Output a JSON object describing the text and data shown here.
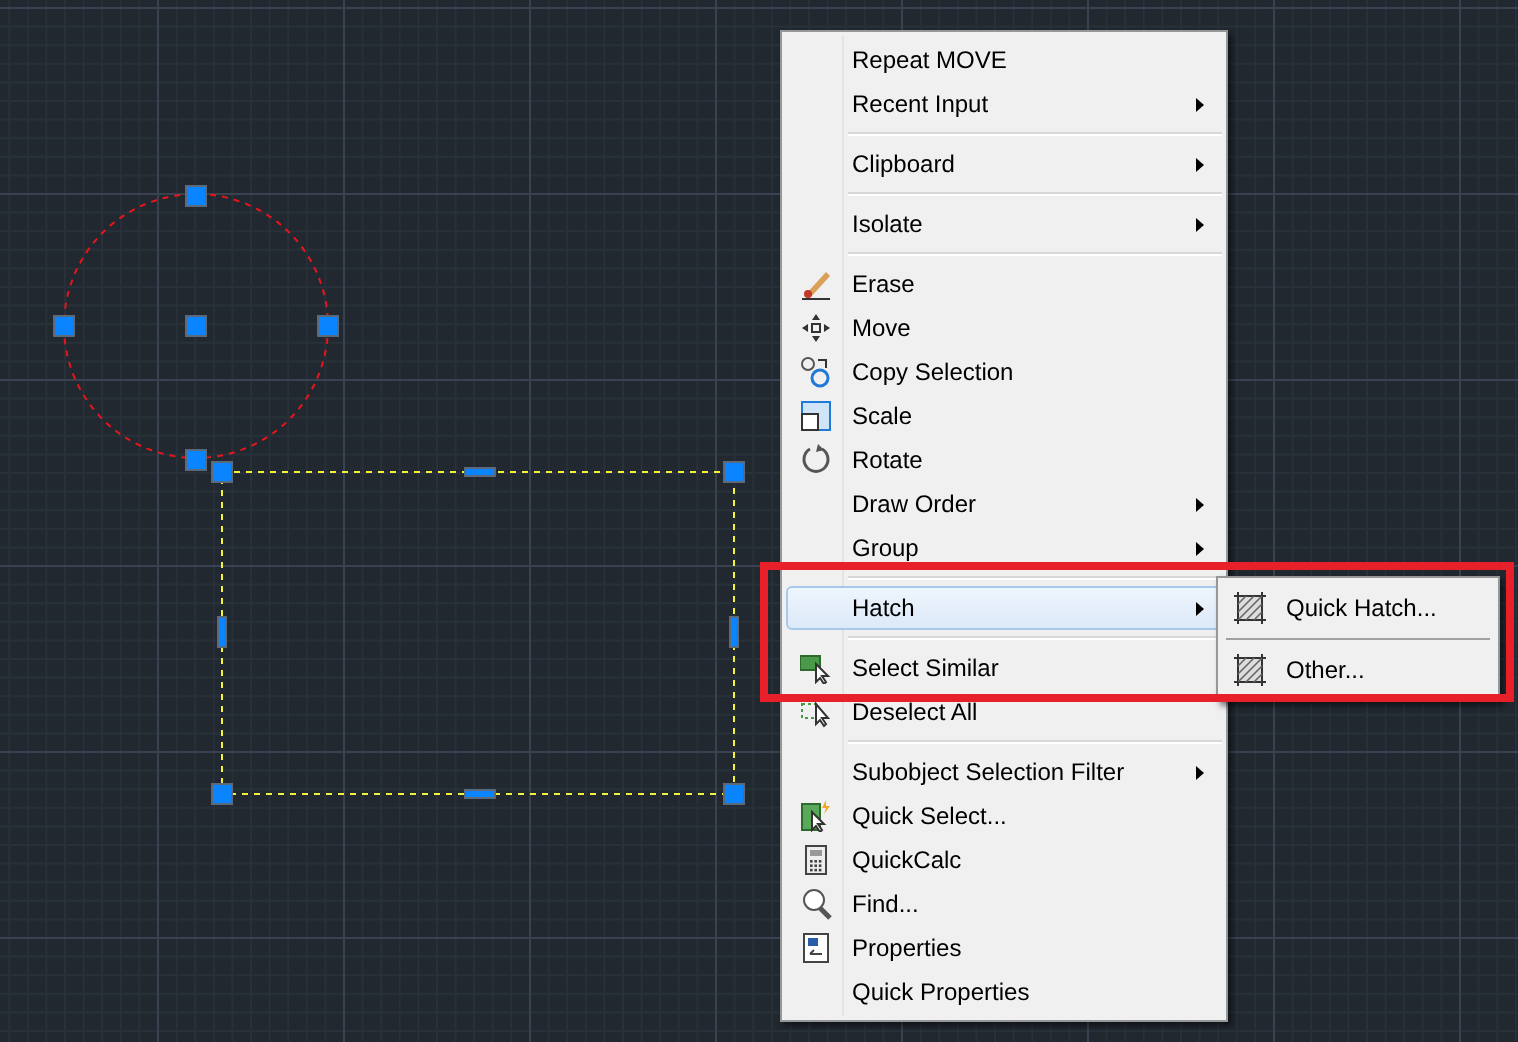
{
  "context_menu": {
    "items": [
      {
        "kind": "item",
        "label": "Repeat MOVE",
        "submenu": false,
        "selected": false
      },
      {
        "kind": "item",
        "label": "Recent Input",
        "submenu": true,
        "selected": false
      },
      {
        "kind": "separator"
      },
      {
        "kind": "item",
        "label": "Clipboard",
        "submenu": true,
        "selected": false
      },
      {
        "kind": "separator"
      },
      {
        "kind": "item",
        "label": "Isolate",
        "submenu": true,
        "selected": false
      },
      {
        "kind": "separator"
      },
      {
        "kind": "item",
        "label": "Erase",
        "submenu": false,
        "selected": false
      },
      {
        "kind": "item",
        "label": "Move",
        "submenu": false,
        "selected": false
      },
      {
        "kind": "item",
        "label": "Copy Selection",
        "submenu": false,
        "selected": false
      },
      {
        "kind": "item",
        "label": "Scale",
        "submenu": false,
        "selected": false
      },
      {
        "kind": "item",
        "label": "Rotate",
        "submenu": false,
        "selected": false
      },
      {
        "kind": "item",
        "label": "Draw Order",
        "submenu": true,
        "selected": false
      },
      {
        "kind": "item",
        "label": "Group",
        "submenu": true,
        "selected": false
      },
      {
        "kind": "separator"
      },
      {
        "kind": "item",
        "label": "Hatch",
        "submenu": true,
        "selected": true
      },
      {
        "kind": "separator"
      },
      {
        "kind": "item",
        "label": "Select Similar",
        "submenu": false,
        "selected": false
      },
      {
        "kind": "item",
        "label": "Deselect All",
        "submenu": false,
        "selected": false
      },
      {
        "kind": "separator"
      },
      {
        "kind": "item",
        "label": "Subobject Selection Filter",
        "submenu": true,
        "selected": false
      },
      {
        "kind": "item",
        "label": "Quick Select...",
        "submenu": false,
        "selected": false
      },
      {
        "kind": "item",
        "label": "QuickCalc",
        "submenu": false,
        "selected": false
      },
      {
        "kind": "item",
        "label": "Find...",
        "submenu": false,
        "selected": false
      },
      {
        "kind": "item",
        "label": "Properties",
        "submenu": false,
        "selected": false
      },
      {
        "kind": "item",
        "label": "Quick Properties",
        "submenu": false,
        "selected": false
      }
    ]
  },
  "submenu": {
    "items": [
      {
        "kind": "item",
        "label": "Quick Hatch..."
      },
      {
        "kind": "separator"
      },
      {
        "kind": "item",
        "label": "Other..."
      }
    ]
  }
}
